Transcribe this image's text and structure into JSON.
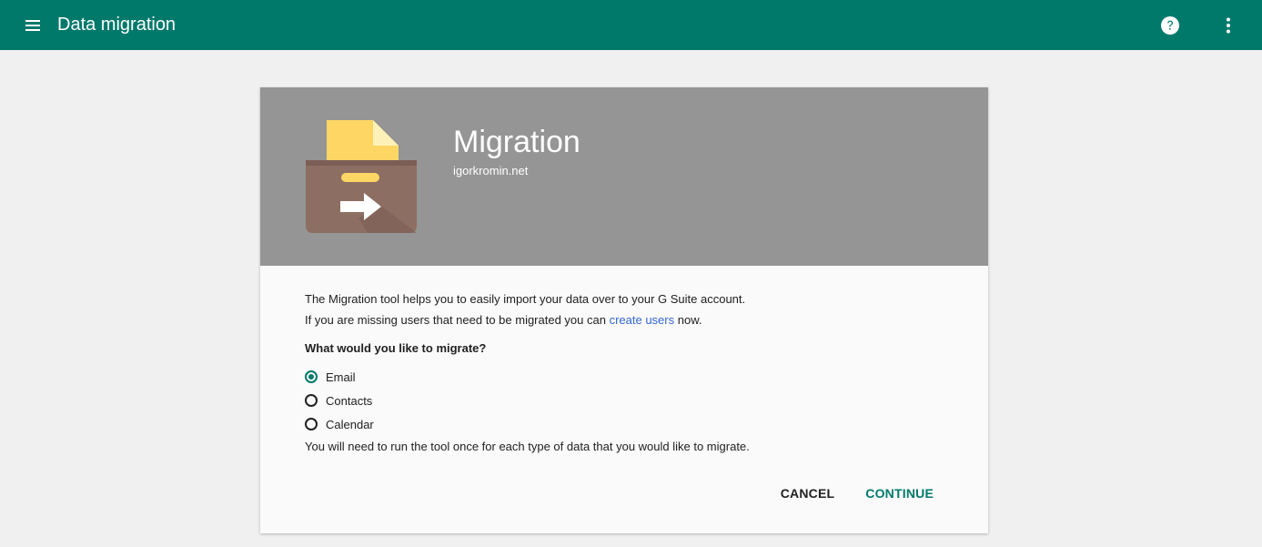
{
  "topbar": {
    "title": "Data migration",
    "menu_icon": "hamburger-menu-icon",
    "help_icon": "help-circle-icon",
    "more_icon": "more-vertical-icon"
  },
  "card": {
    "title": "Migration",
    "subtitle": "igorkromin.net",
    "description": {
      "line1": "The Migration tool helps you to easily import your data over to your G Suite account.",
      "line2_prefix": "If you are missing users that need to be migrated you can ",
      "line2_link": "create users",
      "line2_suffix": " now."
    },
    "question": "What would you like to migrate?",
    "options": [
      {
        "label": "Email",
        "selected": true
      },
      {
        "label": "Contacts",
        "selected": false
      },
      {
        "label": "Calendar",
        "selected": false
      }
    ],
    "note": "You will need to run the tool once for each type of data that you would like to migrate.",
    "actions": {
      "cancel": "CANCEL",
      "continue": "CONTINUE"
    }
  },
  "colors": {
    "topbar": "#00796b",
    "header": "#959595",
    "accent": "#00796b",
    "link": "#3367d6"
  }
}
